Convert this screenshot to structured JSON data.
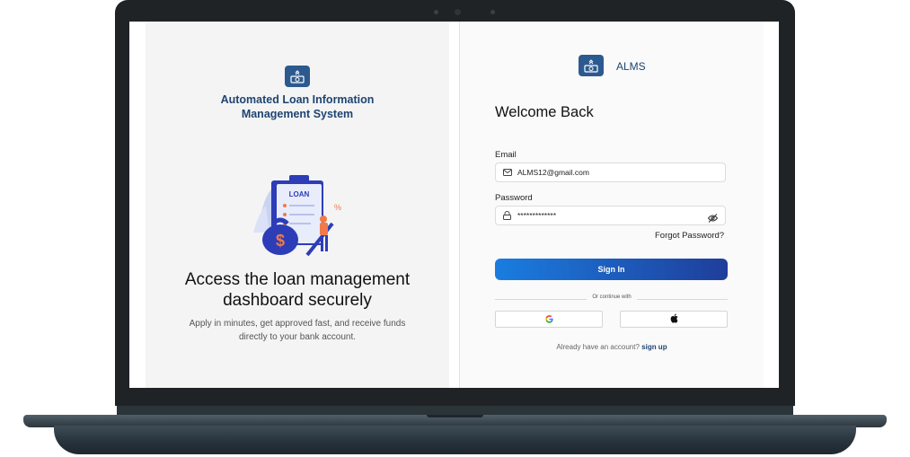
{
  "left": {
    "title_line1": "Automated Loan Information",
    "title_line2": "Management System",
    "illustration_text": "LOAN",
    "heading_line1": "Access the loan management",
    "heading_line2": "dashboard securely",
    "sub_line1": "Apply in minutes, get approved fast, and receive funds",
    "sub_line2": "directly to your bank account."
  },
  "right": {
    "brand": "ALMS",
    "welcome": "Welcome Back",
    "email_label": "Email",
    "email_value": "ALMS12@gmail.com",
    "password_label": "Password",
    "password_value": "*************",
    "forgot": "Forgot Password?",
    "signin": "Sign In",
    "or_continue": "Or continue with",
    "already_text": "Already have an account?",
    "signup": "sign up"
  },
  "icons": {
    "logo": "bank-note-icon",
    "email": "mail-icon",
    "password": "lock-icon",
    "toggle": "eye-off-icon",
    "google": "google-icon",
    "apple": "apple-icon"
  },
  "colors": {
    "brand_navy": "#1e4470",
    "logo_bg": "#2c5a8f",
    "button_start": "#1a7de0",
    "button_end": "#1f3e9a"
  }
}
